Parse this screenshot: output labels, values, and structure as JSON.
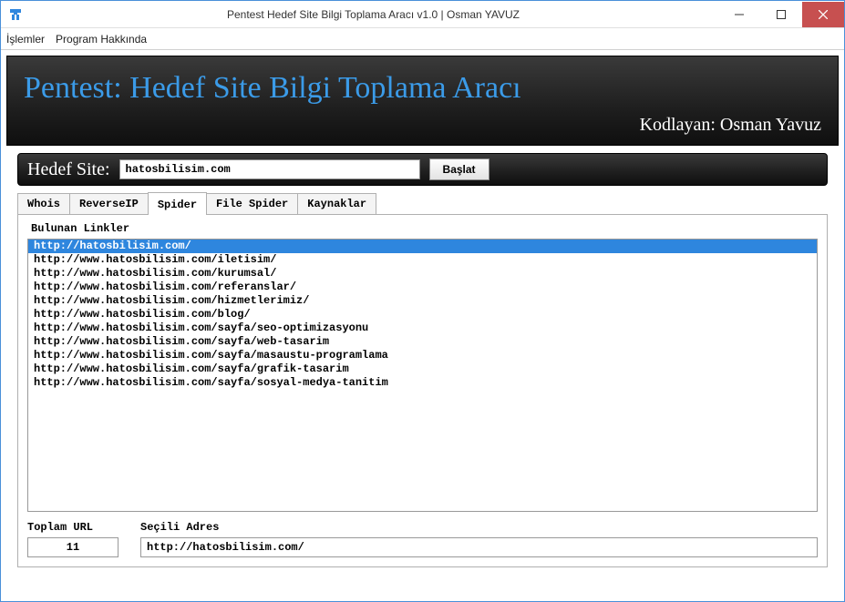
{
  "window": {
    "title": "Pentest Hedef Site Bilgi Toplama Aracı v1.0 | Osman YAVUZ"
  },
  "menu": {
    "items": [
      "İşlemler",
      "Program Hakkında"
    ]
  },
  "banner": {
    "title": "Pentest: Hedef Site Bilgi Toplama Aracı",
    "author": "Kodlayan: Osman Yavuz"
  },
  "target": {
    "label": "Hedef Site:",
    "value": "hatosbilisim.com",
    "start_label": "Başlat"
  },
  "tabs": {
    "items": [
      "Whois",
      "ReverseIP",
      "Spider",
      "File Spider",
      "Kaynaklar"
    ],
    "active_index": 2
  },
  "spider": {
    "group_label": "Bulunan Linkler",
    "selected_index": 0,
    "links": [
      "http://hatosbilisim.com/",
      "http://www.hatosbilisim.com/iletisim/",
      "http://www.hatosbilisim.com/kurumsal/",
      "http://www.hatosbilisim.com/referanslar/",
      "http://www.hatosbilisim.com/hizmetlerimiz/",
      "http://www.hatosbilisim.com/blog/",
      "http://www.hatosbilisim.com/sayfa/seo-optimizasyonu",
      "http://www.hatosbilisim.com/sayfa/web-tasarim",
      "http://www.hatosbilisim.com/sayfa/masaustu-programlama",
      "http://www.hatosbilisim.com/sayfa/grafik-tasarim",
      "http://www.hatosbilisim.com/sayfa/sosyal-medya-tanitim"
    ],
    "total_label": "Toplam URL",
    "total_value": "11",
    "selected_label": "Seçili Adres",
    "selected_value": "http://hatosbilisim.com/"
  }
}
